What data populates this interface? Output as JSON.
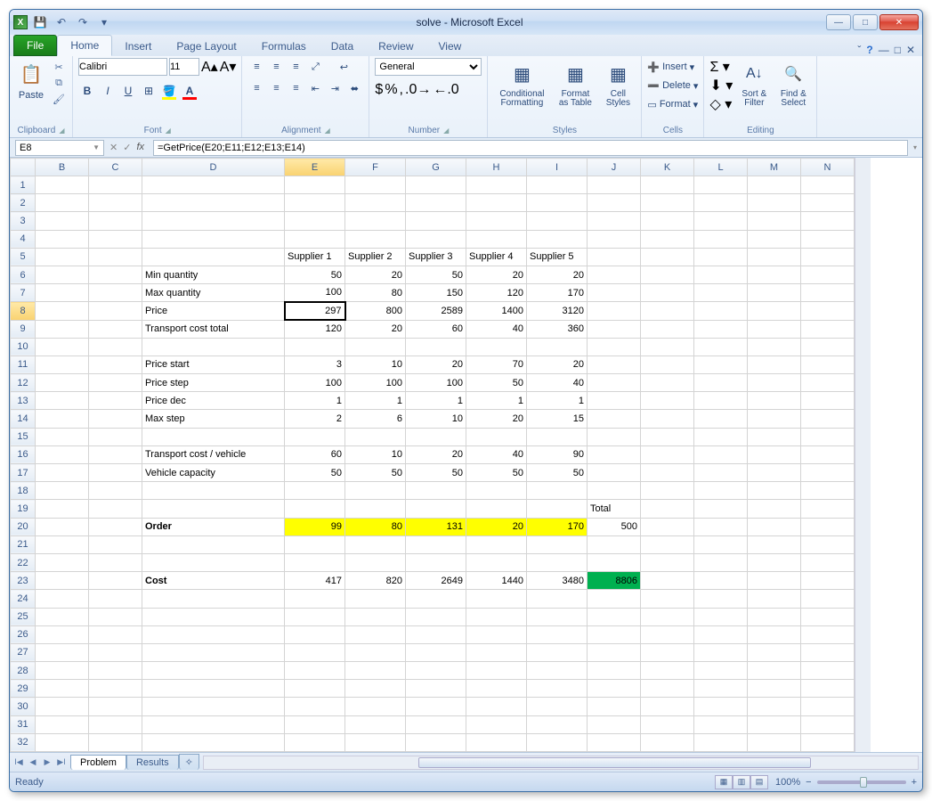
{
  "titlebar": {
    "title": "solve  -  Microsoft Excel"
  },
  "ribbon_tabs": {
    "file": "File",
    "home": "Home",
    "insert": "Insert",
    "pagelayout": "Page Layout",
    "formulas": "Formulas",
    "data": "Data",
    "review": "Review",
    "view": "View"
  },
  "ribbon": {
    "clipboard": {
      "paste": "Paste",
      "label": "Clipboard"
    },
    "font": {
      "name": "Calibri",
      "size": "11",
      "label": "Font"
    },
    "alignment": {
      "label": "Alignment"
    },
    "number": {
      "format": "General",
      "label": "Number"
    },
    "styles": {
      "cond": "Conditional Formatting",
      "table": "Format as Table",
      "cell": "Cell Styles",
      "label": "Styles"
    },
    "cells": {
      "insert": "Insert",
      "delete": "Delete",
      "format": "Format",
      "label": "Cells"
    },
    "editing": {
      "sort": "Sort & Filter",
      "find": "Find & Select",
      "label": "Editing"
    }
  },
  "formulabar": {
    "cell": "E8",
    "formula": "=GetPrice(E20;E11;E12;E13;E14)"
  },
  "columns": [
    "B",
    "C",
    "D",
    "E",
    "F",
    "G",
    "H",
    "I",
    "J",
    "K",
    "L",
    "M",
    "N"
  ],
  "colwidths": {
    "B": 60,
    "C": 60,
    "D": 160,
    "E": 68,
    "F": 68,
    "G": 68,
    "H": 68,
    "I": 68,
    "J": 60,
    "K": 60,
    "L": 60,
    "M": 60,
    "N": 60
  },
  "sheet": {
    "rows": [
      1,
      2,
      3,
      4,
      5,
      6,
      7,
      8,
      9,
      10,
      11,
      12,
      13,
      14,
      15,
      16,
      17,
      18,
      19,
      20,
      21,
      22,
      23,
      24,
      25,
      26,
      27,
      28,
      29,
      30,
      31,
      32
    ],
    "r5": {
      "E": "Supplier 1",
      "F": "Supplier 2",
      "G": "Supplier 3",
      "H": "Supplier 4",
      "I": "Supplier 5"
    },
    "r6": {
      "D": "Min quantity",
      "E": "50",
      "F": "20",
      "G": "50",
      "H": "20",
      "I": "20"
    },
    "r7": {
      "D": "Max quantity",
      "E": "100",
      "F": "80",
      "G": "150",
      "H": "120",
      "I": "170"
    },
    "r8": {
      "D": "Price",
      "E": "297",
      "F": "800",
      "G": "2589",
      "H": "1400",
      "I": "3120"
    },
    "r9": {
      "D": "Transport cost total",
      "E": "120",
      "F": "20",
      "G": "60",
      "H": "40",
      "I": "360"
    },
    "r11": {
      "D": "Price start",
      "E": "3",
      "F": "10",
      "G": "20",
      "H": "70",
      "I": "20"
    },
    "r12": {
      "D": "Price step",
      "E": "100",
      "F": "100",
      "G": "100",
      "H": "50",
      "I": "40"
    },
    "r13": {
      "D": "Price dec",
      "E": "1",
      "F": "1",
      "G": "1",
      "H": "1",
      "I": "1"
    },
    "r14": {
      "D": "Max step",
      "E": "2",
      "F": "6",
      "G": "10",
      "H": "20",
      "I": "15"
    },
    "r16": {
      "D": "Transport cost / vehicle",
      "E": "60",
      "F": "10",
      "G": "20",
      "H": "40",
      "I": "90"
    },
    "r17": {
      "D": "Vehicle capacity",
      "E": "50",
      "F": "50",
      "G": "50",
      "H": "50",
      "I": "50"
    },
    "r19": {
      "J": "Total"
    },
    "r20": {
      "D": "Order",
      "E": "99",
      "F": "80",
      "G": "131",
      "H": "20",
      "I": "170",
      "J": "500"
    },
    "r23": {
      "D": "Cost",
      "E": "417",
      "F": "820",
      "G": "2649",
      "H": "1440",
      "I": "3480",
      "J": "8806"
    }
  },
  "tabs": {
    "t1": "Problem",
    "t2": "Results"
  },
  "statusbar": {
    "ready": "Ready",
    "zoom": "100%"
  }
}
